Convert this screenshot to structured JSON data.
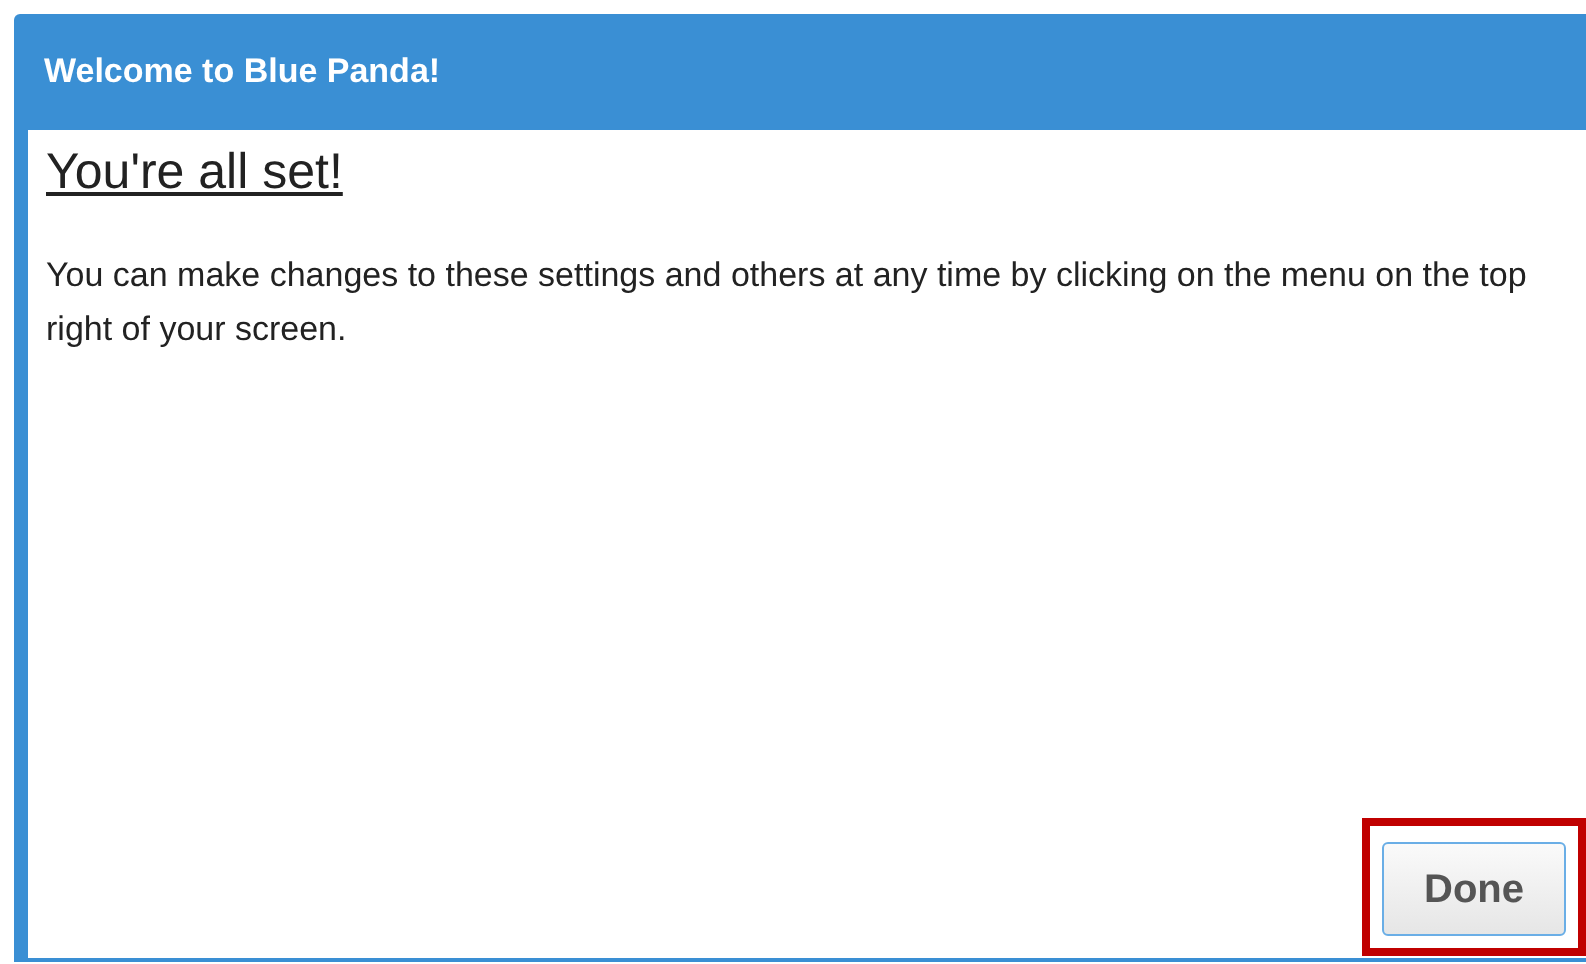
{
  "window": {
    "title": "Welcome to Blue Panda!"
  },
  "heading": "You're all set!",
  "message": "You can make changes to these settings and others at any time by clicking on the menu on the top right of your screen.",
  "buttons": [
    {
      "label": "Done",
      "highlighted": true
    }
  ]
}
